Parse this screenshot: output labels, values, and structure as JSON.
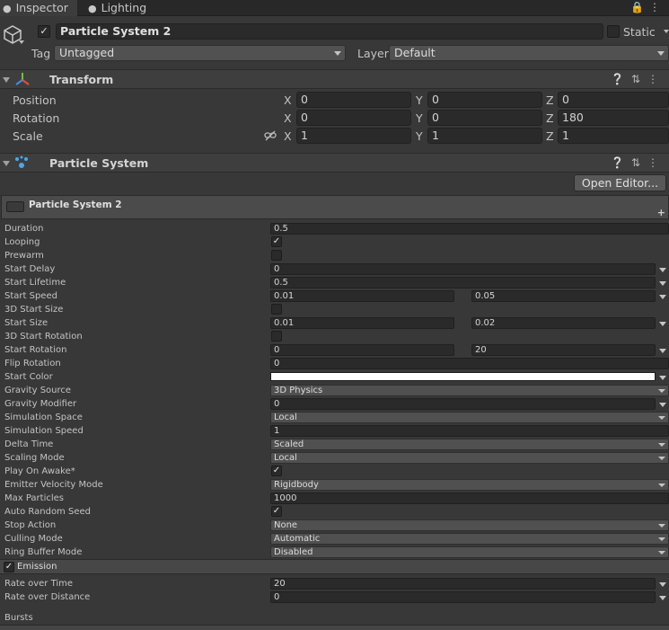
{
  "tabs": [
    {
      "label": "Inspector",
      "icon": "info-icon"
    },
    {
      "label": "Lighting",
      "icon": "bulb-icon"
    }
  ],
  "object": {
    "name": "Particle System 2",
    "static_label": "Static",
    "tag_label": "Tag",
    "tag_value": "Untagged",
    "layer_label": "Layer",
    "layer_value": "Default"
  },
  "transform": {
    "title": "Transform",
    "rows": [
      {
        "label": "Position",
        "x": "0",
        "y": "0",
        "z": "0"
      },
      {
        "label": "Rotation",
        "x": "0",
        "y": "0",
        "z": "180"
      },
      {
        "label": "Scale",
        "x": "1",
        "y": "1",
        "z": "1"
      }
    ],
    "axis": {
      "x": "X",
      "y": "Y",
      "z": "Z"
    }
  },
  "particle_system": {
    "title": "Particle System",
    "open_editor": "Open Editor...",
    "module_title": "Particle System 2",
    "plus": "+",
    "props": {
      "duration": {
        "label": "Duration",
        "value": "0.5"
      },
      "looping": {
        "label": "Looping"
      },
      "prewarm": {
        "label": "Prewarm"
      },
      "start_delay": {
        "label": "Start Delay",
        "value": "0"
      },
      "start_lifetime": {
        "label": "Start Lifetime",
        "value": "0.5"
      },
      "start_speed": {
        "label": "Start Speed",
        "min": "0.01",
        "max": "0.05"
      },
      "start_size_3d": {
        "label": "3D Start Size"
      },
      "start_size": {
        "label": "Start Size",
        "min": "0.01",
        "max": "0.02"
      },
      "start_rotation_3d": {
        "label": "3D Start Rotation"
      },
      "start_rotation": {
        "label": "Start Rotation",
        "min": "0",
        "max": "20"
      },
      "flip_rotation": {
        "label": "Flip Rotation",
        "value": "0"
      },
      "start_color": {
        "label": "Start Color",
        "color": "#ffffff"
      },
      "gravity_source": {
        "label": "Gravity Source",
        "value": "3D Physics"
      },
      "gravity_modifier": {
        "label": "Gravity Modifier",
        "value": "0"
      },
      "simulation_space": {
        "label": "Simulation Space",
        "value": "Local"
      },
      "simulation_speed": {
        "label": "Simulation Speed",
        "value": "1"
      },
      "delta_time": {
        "label": "Delta Time",
        "value": "Scaled"
      },
      "scaling_mode": {
        "label": "Scaling Mode",
        "value": "Local"
      },
      "play_on_awake": {
        "label": "Play On Awake*"
      },
      "emitter_velocity_mode": {
        "label": "Emitter Velocity Mode",
        "value": "Rigidbody"
      },
      "max_particles": {
        "label": "Max Particles",
        "value": "1000"
      },
      "auto_random_seed": {
        "label": "Auto Random Seed"
      },
      "stop_action": {
        "label": "Stop Action",
        "value": "None"
      },
      "culling_mode": {
        "label": "Culling Mode",
        "value": "Automatic"
      },
      "ring_buffer_mode": {
        "label": "Ring Buffer Mode",
        "value": "Disabled"
      }
    },
    "emission": {
      "title": "Emission",
      "rate_over_time": {
        "label": "Rate over Time",
        "value": "20"
      },
      "rate_over_distance": {
        "label": "Rate over Distance",
        "value": "0"
      },
      "bursts_label": "Bursts"
    }
  }
}
